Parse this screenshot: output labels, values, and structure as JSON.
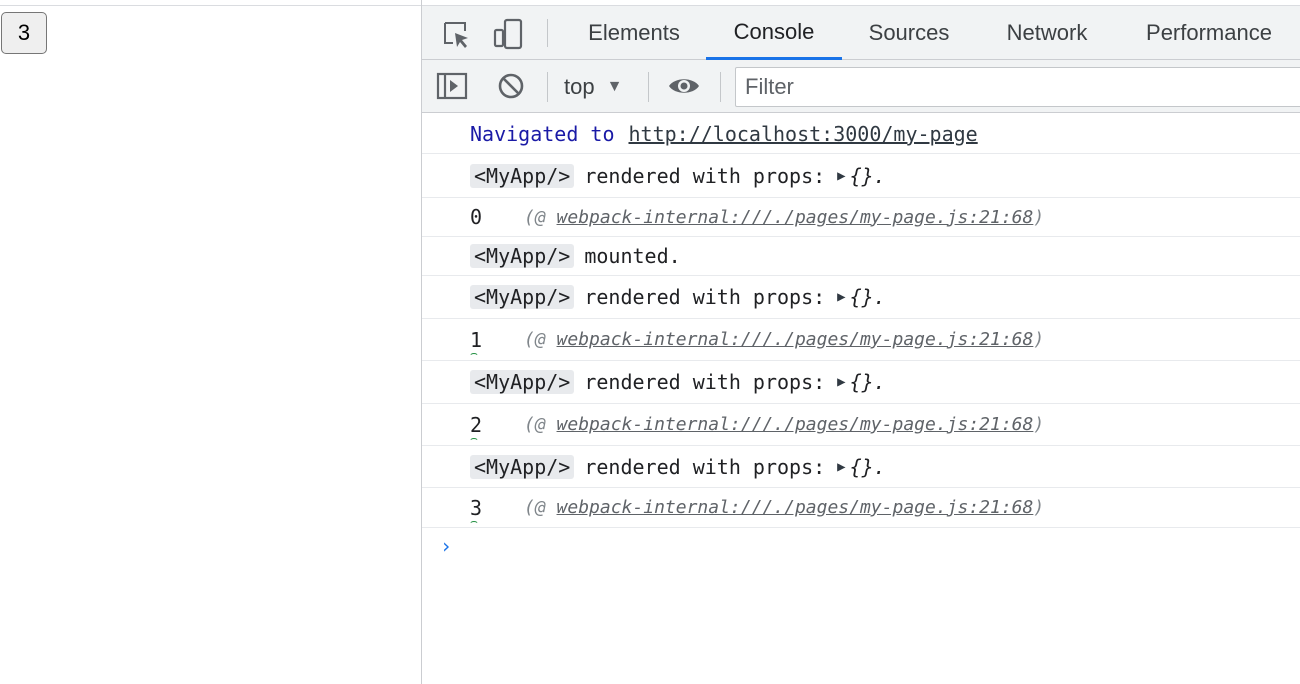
{
  "page": {
    "counter_button": "3"
  },
  "devtools": {
    "tabs": [
      {
        "label": "Elements"
      },
      {
        "label": "Console"
      },
      {
        "label": "Sources"
      },
      {
        "label": "Network"
      },
      {
        "label": "Performance"
      }
    ],
    "active_tab": "Console",
    "toolbar": {
      "context": "top",
      "filter_placeholder": "Filter"
    },
    "icons": {
      "inspect": "inspect-element-icon",
      "device": "device-toolbar-icon",
      "sidebar": "show-sidebar-icon",
      "clear": "clear-console-icon",
      "eye": "live-expression-icon"
    },
    "colors": {
      "accent": "#1a73e8",
      "nav_text": "#1a1aa6",
      "tag_bg": "#e8eaed"
    }
  },
  "console": {
    "nav": {
      "text": "Navigated to",
      "url": "http://localhost:3000/my-page"
    },
    "tag": "<MyApp/>",
    "rendered_text": "rendered with props:",
    "props": "{}.",
    "mounted_text": "mounted.",
    "source_prefix": "(@",
    "source_link": "webpack-internal:///./pages/my-page.js:21:68",
    "source_suffix": ")",
    "logs": [
      "0",
      "1",
      "2",
      "3"
    ]
  }
}
